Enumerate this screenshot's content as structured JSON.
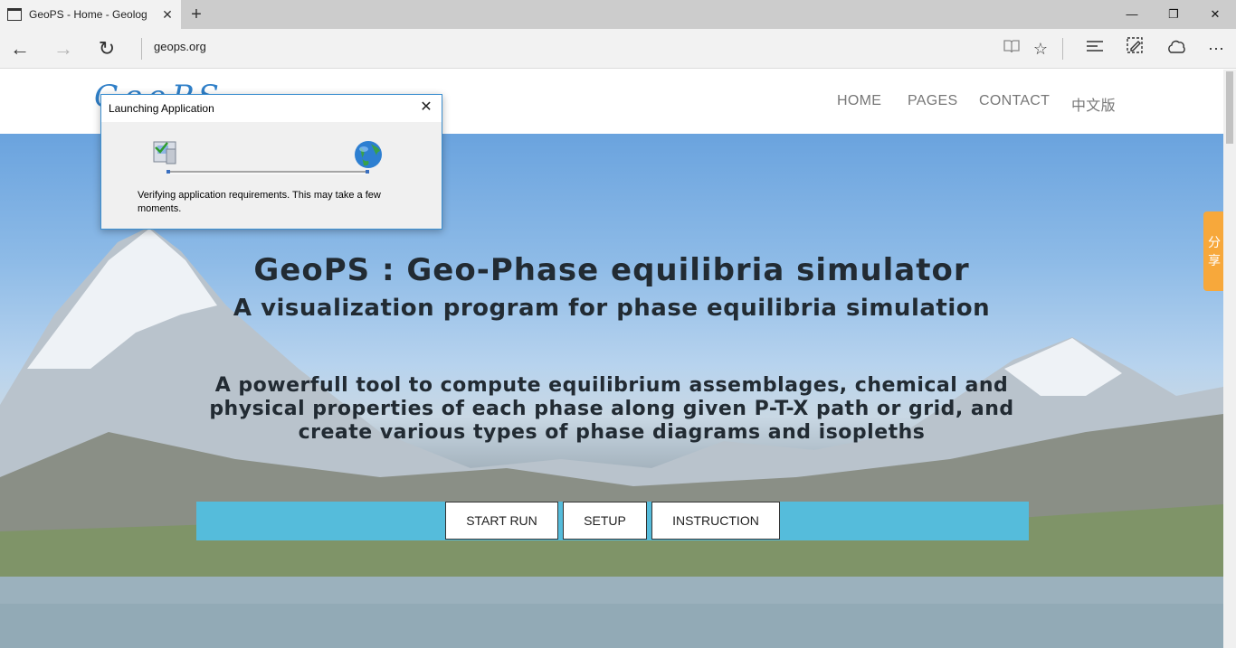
{
  "browser": {
    "tab_title": "GeoPS - Home - Geolog",
    "address": "geops.org",
    "icons": [
      "back-icon",
      "forward-icon",
      "refresh-icon",
      "reading-view-icon",
      "favorite-star-icon",
      "hub-icon",
      "web-note-icon",
      "share-icon",
      "more-icon"
    ]
  },
  "site": {
    "logo_text": "GeoPS",
    "nav": [
      "HOME",
      "PAGES",
      "CONTACT",
      "中文版"
    ],
    "hero": {
      "title": "GeoPS : Geo-Phase equilibria simulator",
      "subtitle": "A visualization program for phase equilibria simulation",
      "description": "A powerfull tool to compute equilibrium assemblages, chemical and physical properties of each phase along given P-T-X path or grid, and create various types of phase diagrams and isopleths"
    },
    "buttons": [
      "START RUN",
      "SETUP",
      "INSTRUCTION"
    ],
    "share_tab": [
      "分",
      "享"
    ],
    "colors": {
      "cta_bar": "#55bcdb",
      "share_tab": "#f7a83b",
      "title_text": "#222b33"
    }
  },
  "dialog": {
    "title": "Launching Application",
    "message": "Verifying application requirements. This may take a few moments."
  }
}
